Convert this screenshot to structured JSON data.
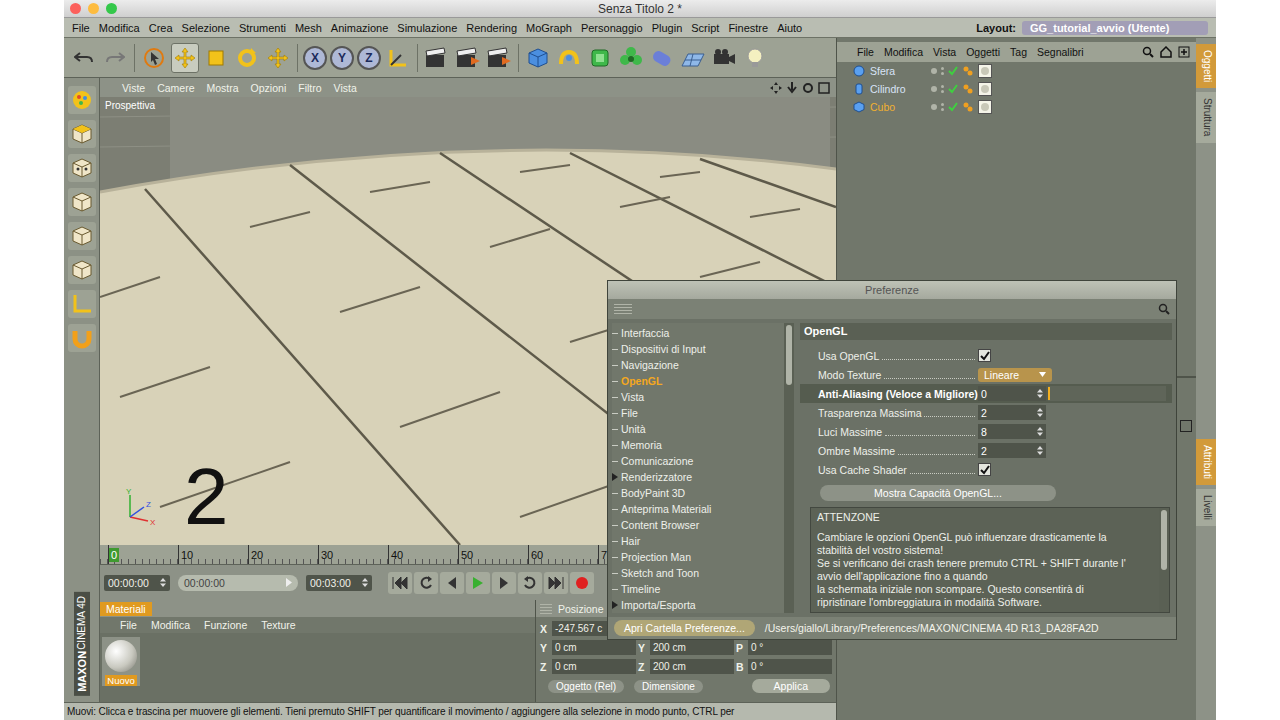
{
  "window": {
    "title": "Senza Titolo 2 *"
  },
  "menu": [
    "File",
    "Modifica",
    "Crea",
    "Selezione",
    "Strumenti",
    "Mesh",
    "Animazione",
    "Simulazione",
    "Rendering",
    "MoGraph",
    "Personaggio",
    "Plugin",
    "Script",
    "Finestre",
    "Aiuto"
  ],
  "layout": {
    "label": "Layout:",
    "value": "GG_tutorial_avvio (Utente)"
  },
  "toolbar": {
    "tools": [
      {
        "kind": "select",
        "selected": false
      },
      {
        "kind": "move",
        "selected": true
      },
      {
        "kind": "scale",
        "selected": false
      },
      {
        "kind": "rotate",
        "selected": false
      },
      {
        "kind": "recent",
        "selected": false
      }
    ],
    "axes": [
      {
        "label": "X",
        "on": true
      },
      {
        "label": "Y",
        "on": true
      },
      {
        "label": "Z",
        "on": true
      }
    ]
  },
  "viewport": {
    "menu": [
      "Viste",
      "Camere",
      "Mostra",
      "Opzioni",
      "Filtro",
      "Vista"
    ],
    "camera": "Prospettiva",
    "overlay": "2",
    "gizmo": [
      "X",
      "Y",
      "Z"
    ]
  },
  "object_manager": {
    "menu": [
      "File",
      "Modifica",
      "Vista",
      "Oggetti",
      "Tag",
      "Segnalibri"
    ],
    "objects": [
      {
        "name": "Sfera",
        "kind": "sphere",
        "selected": false,
        "enabled": true
      },
      {
        "name": "Cilindro",
        "kind": "cylinder",
        "selected": false,
        "enabled": true
      },
      {
        "name": "Cubo",
        "kind": "cube",
        "selected": true,
        "enabled": true
      }
    ]
  },
  "side_tabs": {
    "top": [
      {
        "label": "Oggetti",
        "selected": true
      },
      {
        "label": "Struttura",
        "selected": false
      }
    ],
    "bottom": [
      {
        "label": "Attributi",
        "selected": true
      },
      {
        "label": "Livelli",
        "selected": false
      }
    ]
  },
  "timeline": {
    "ticks": [
      {
        "label": "0",
        "selected": true
      },
      {
        "label": "10",
        "selected": false
      },
      {
        "label": "20",
        "selected": false
      },
      {
        "label": "30",
        "selected": false
      },
      {
        "label": "40",
        "selected": false
      },
      {
        "label": "50",
        "selected": false
      },
      {
        "label": "60",
        "selected": false
      },
      {
        "label": "7",
        "selected": false
      }
    ],
    "start": "00:00:00",
    "position": "00:00:00",
    "end": "00:03:00"
  },
  "materials": {
    "tab": "Materiali",
    "menu": [
      "File",
      "Modifica",
      "Funzione",
      "Texture"
    ],
    "items": [
      {
        "name": "Nuovo",
        "selected": true
      }
    ]
  },
  "coordinates": {
    "header": "Posizione",
    "position": [
      {
        "axis": "X",
        "value": "-247.567 c"
      },
      {
        "axis": "Y",
        "value": "0 cm"
      },
      {
        "axis": "Z",
        "value": "0 cm"
      }
    ],
    "size": [
      {
        "axis": "Y",
        "value": "200 cm"
      },
      {
        "axis": "Z",
        "value": "200 cm"
      }
    ],
    "rotation": [
      {
        "axis": "P",
        "value": "0 °"
      },
      {
        "axis": "B",
        "value": "0 °"
      }
    ],
    "mode": "Oggetto (Rel)",
    "size_mode": "Dimensione",
    "apply": "Applica"
  },
  "status_bar": "Muovi: Clicca e trascina per muovere gli elementi. Tieni premuto SHIFT per quantificare il movimento / aggiungere alla selezione in modo punto, CTRL per",
  "logo": [
    "MAXON",
    "CINEMA 4D"
  ],
  "preferences": {
    "title": "Preferenze",
    "categories": [
      {
        "label": "Interfaccia",
        "selected": false,
        "expandable": false
      },
      {
        "label": "Dispositivi di Input",
        "selected": false,
        "expandable": false
      },
      {
        "label": "Navigazione",
        "selected": false,
        "expandable": false
      },
      {
        "label": "OpenGL",
        "selected": true,
        "expandable": false
      },
      {
        "label": "Vista",
        "selected": false,
        "expandable": false
      },
      {
        "label": "File",
        "selected": false,
        "expandable": false
      },
      {
        "label": "Unità",
        "selected": false,
        "expandable": false
      },
      {
        "label": "Memoria",
        "selected": false,
        "expandable": false
      },
      {
        "label": "Comunicazione",
        "selected": false,
        "expandable": false
      },
      {
        "label": "Renderizzatore",
        "selected": false,
        "expandable": true
      },
      {
        "label": "BodyPaint 3D",
        "selected": false,
        "expandable": false
      },
      {
        "label": "Anteprima Materiali",
        "selected": false,
        "expandable": false
      },
      {
        "label": "Content Browser",
        "selected": false,
        "expandable": false
      },
      {
        "label": "Hair",
        "selected": false,
        "expandable": false
      },
      {
        "label": "Projection Man",
        "selected": false,
        "expandable": false
      },
      {
        "label": "Sketch and Toon",
        "selected": false,
        "expandable": false
      },
      {
        "label": "Timeline",
        "selected": false,
        "expandable": false
      },
      {
        "label": "Importa/Esporta",
        "selected": false,
        "expandable": true
      }
    ],
    "section": "OpenGL",
    "settings": [
      {
        "label": "Usa OpenGL",
        "kind": "checkbox",
        "checked": true,
        "selected": false
      },
      {
        "label": "Modo Texture",
        "kind": "dropdown",
        "value": "Lineare",
        "selected": false
      },
      {
        "label": "Anti-Aliasing (Veloce a Migliore)",
        "kind": "slider",
        "value": "0",
        "level": 0,
        "selected": true
      },
      {
        "label": "Trasparenza Massima",
        "kind": "number",
        "value": "2",
        "selected": false
      },
      {
        "label": "Luci Massime",
        "kind": "number",
        "value": "8",
        "selected": false
      },
      {
        "label": "Ombre Massime",
        "kind": "number",
        "value": "2",
        "selected": false
      },
      {
        "label": "Usa Cache Shader",
        "kind": "checkbox",
        "checked": true,
        "selected": false
      }
    ],
    "capabilities_button": "Mostra Capacità OpenGL...",
    "warning": {
      "title": "ATTENZONE",
      "lines": [
        "Cambiare le opzioni OpenGL può influenzare drasticamente la",
        "stabilità del vostro sistema!",
        "Se si verificano dei crash tenere premuto CTRL + SHIFT durante l'",
        "avvio dell'applicazione fino a quando",
        "la schermata iniziale non scompare. Questo consentirà di",
        "ripristinare l'ombreggiatura in modalità Software."
      ]
    },
    "folder_button": "Apri Cartella Preferenze...",
    "path": "/Users/giallo/Library/Preferences/MAXON/CINEMA 4D R13_DA28FA2D"
  }
}
